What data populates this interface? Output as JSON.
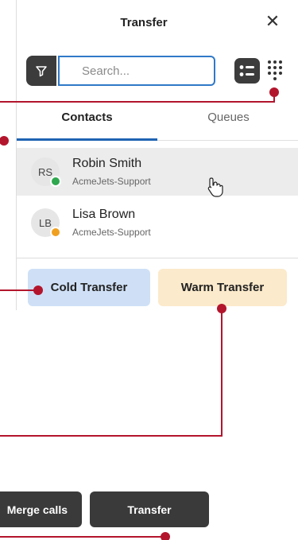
{
  "header": {
    "title": "Transfer",
    "close_icon": "close-icon"
  },
  "search": {
    "placeholder": "Search..."
  },
  "tabs": [
    {
      "label": "Contacts",
      "active": true
    },
    {
      "label": "Queues",
      "active": false
    }
  ],
  "contacts": [
    {
      "initials": "RS",
      "name": "Robin Smith",
      "team": "AcmeJets-Support",
      "status_color": "#2fa84f"
    },
    {
      "initials": "LB",
      "name": "Lisa Brown",
      "team": "AcmeJets-Support",
      "status_color": "#f0a020"
    }
  ],
  "actions": {
    "cold_label": "Cold Transfer",
    "warm_label": "Warm Transfer"
  },
  "bottom": {
    "merge_label": "Merge calls",
    "transfer_label": "Transfer"
  },
  "colors": {
    "callout": "#b3152d",
    "accent": "#1f63b3"
  }
}
